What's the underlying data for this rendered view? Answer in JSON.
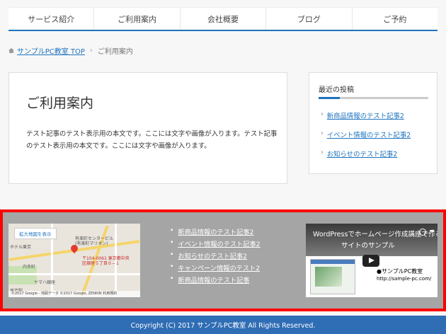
{
  "nav": {
    "items": [
      "サービス紹介",
      "ご利用案内",
      "会社概要",
      "ブログ",
      "ご予約"
    ]
  },
  "breadcrumb": {
    "home": "サンプルPC教室 TOP",
    "separator": "›",
    "current": "ご利用案内"
  },
  "main": {
    "title": "ご利用案内",
    "body": "テスト記事のテスト表示用の本文です。ここには文字や画像が入ります。テスト記事のテスト表示用の本文です。ここには文字や画像が入ります。"
  },
  "sidebar": {
    "heading": "最近の投稿",
    "items": [
      "新商品情報のテスト記事2",
      "イベント情報のテスト記事2",
      "お知らせのテスト記事2"
    ]
  },
  "footer": {
    "map": {
      "zoom_link": "拡大地図を表示",
      "labels": [
        "有楽町センタービル",
        "(有楽町マリオン)",
        "〒104-0061 東京都中央",
        "区銀座５丁目６−１",
        "ホテル東京",
        "内幸町",
        "ヤマハ銀座",
        "東京駅"
      ],
      "credit": "©2017 Google - 地図データ ©2017 Google, ZENRIN  利用規約"
    },
    "links": [
      "新商品情報のテスト記事2",
      "イベント情報のテスト記事2",
      "お知らせのテスト記事2",
      "キャンペーン情報のテスト2",
      "新商品情報のテスト記事"
    ],
    "video": {
      "title": "WordPressでホームページ作成講座で作る",
      "subtitle": "サイトのサンプル",
      "caption": "●サンプルPC教室",
      "url": "http://sample-pc.com/"
    }
  },
  "copyright": "Copyright (C) 2017 サンプルPC教室 All Rights Reserved.",
  "colors": {
    "accent": "#1e73be",
    "highlight_border": "#ff0000",
    "footer_bg": "#a5a5a5",
    "copyright_bg": "#2f6db5"
  }
}
